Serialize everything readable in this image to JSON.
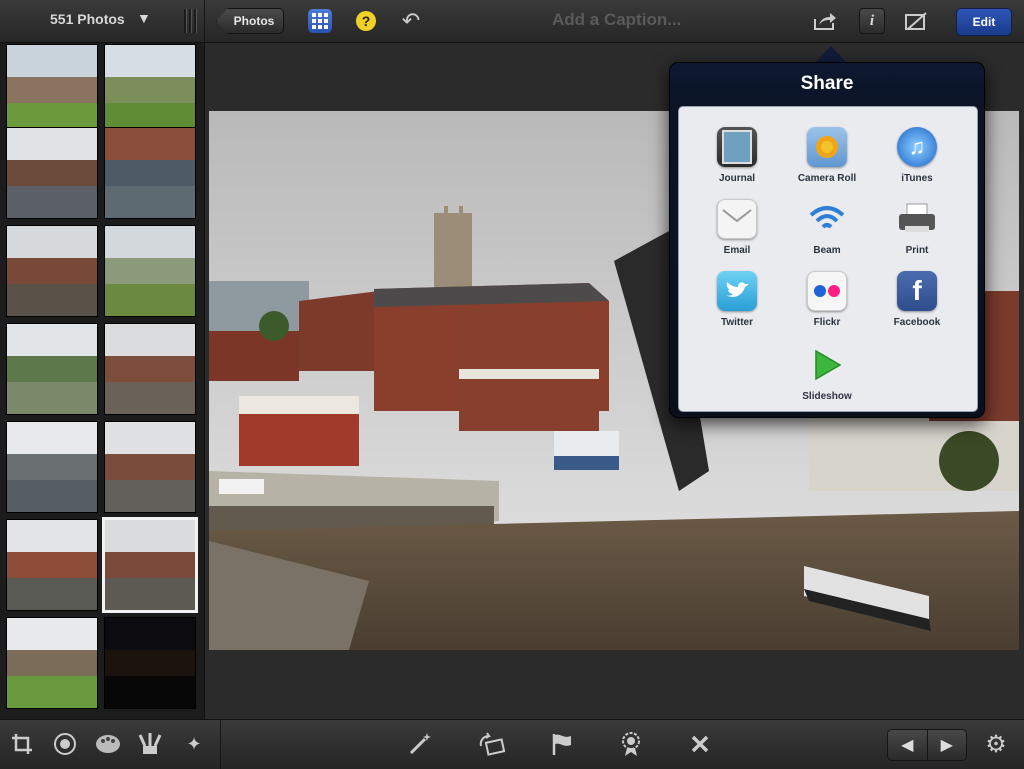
{
  "topbar": {
    "photo_count": "551 Photos",
    "count_caret": "▼",
    "back_label": "Photos",
    "help_glyph": "?",
    "undo_glyph": "↶",
    "caption_placeholder": "Add a Caption...",
    "info_glyph": "i",
    "edit_label": "Edit",
    "icons": [
      "grid-icon",
      "help-icon",
      "undo-icon",
      "share-icon",
      "info-icon",
      "crop-corner-icon"
    ]
  },
  "share": {
    "title": "Share",
    "items": [
      {
        "label": "Journal",
        "icon": "journal-icon"
      },
      {
        "label": "Camera Roll",
        "icon": "camera-roll-icon"
      },
      {
        "label": "iTunes",
        "icon": "itunes-icon"
      },
      {
        "label": "Email",
        "icon": "email-icon"
      },
      {
        "label": "Beam",
        "icon": "beam-icon"
      },
      {
        "label": "Print",
        "icon": "print-icon"
      },
      {
        "label": "Twitter",
        "icon": "twitter-icon"
      },
      {
        "label": "Flickr",
        "icon": "flickr-icon"
      },
      {
        "label": "Facebook",
        "icon": "facebook-icon"
      },
      {
        "label": "Slideshow",
        "icon": "slideshow-icon"
      }
    ]
  },
  "thumbnails": {
    "count": 14,
    "selected_index": 11
  },
  "bottombar": {
    "left_tools": [
      "crop-icon",
      "exposure-icon",
      "color-palette-icon",
      "brushes-icon",
      "effects-icon"
    ],
    "center_tools": [
      "auto-enhance-icon",
      "rotate-icon",
      "flag-icon",
      "favorite-icon",
      "hide-icon"
    ],
    "prev_glyph": "◀",
    "next_glyph": "▶",
    "settings_glyph": "⚙"
  },
  "colors": {
    "accent_blue": "#2a52b0",
    "toolbar_bg": "#2e2e2e",
    "share_bg": "#0c1426",
    "share_panel": "#e9ebef"
  }
}
